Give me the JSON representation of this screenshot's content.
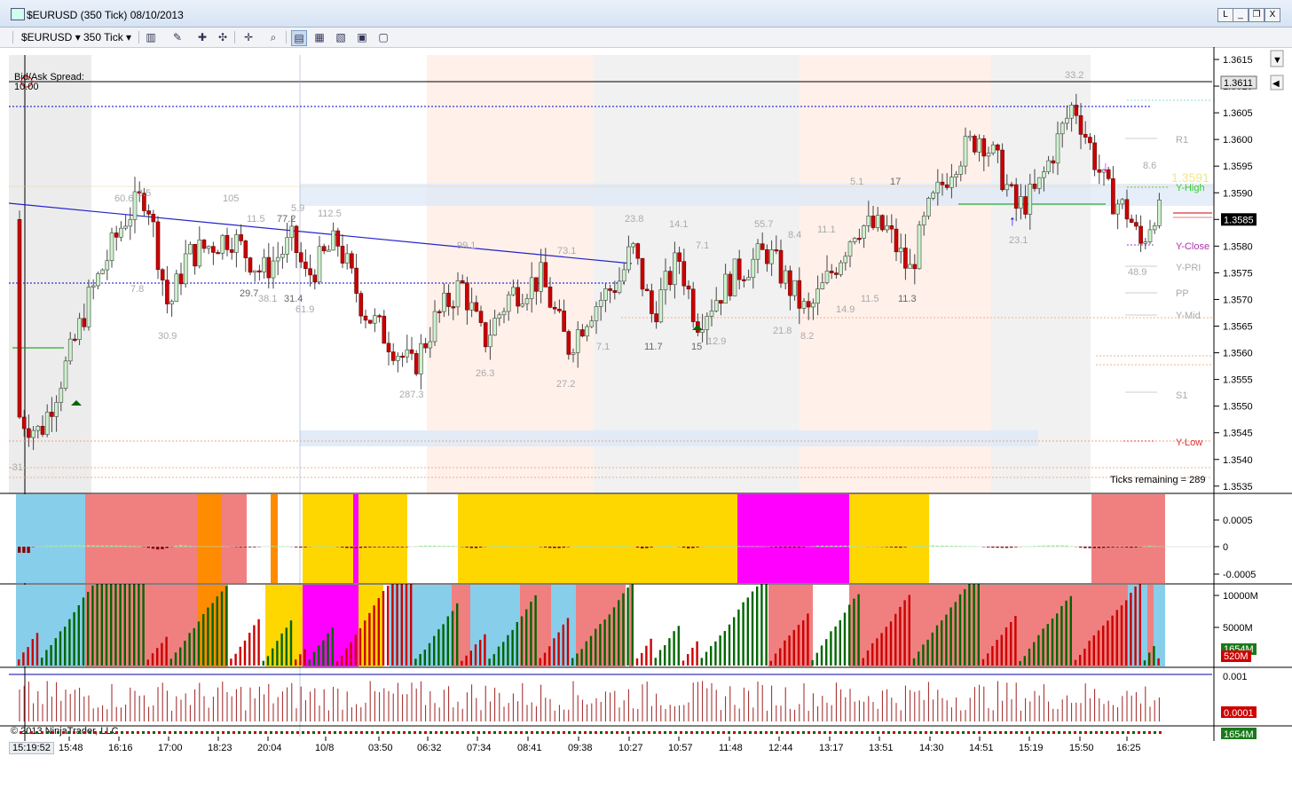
{
  "window": {
    "title": "$EURUSD (350 Tick)  08/10/2013",
    "btn_help": "L",
    "btn_min": "_",
    "btn_max": "❐",
    "btn_close": "X"
  },
  "toolbar": {
    "instrument": "$EURUSD",
    "interval": "350 Tick"
  },
  "chart": {
    "bid_ask_label": "Bid/Ask Spread:",
    "bid_ask_value": "10.00",
    "ticks_remaining": "Ticks remaining = 289",
    "copyright": "© 2013 NinjaTrader, LLC",
    "cursor_time": "15:19:52",
    "price_axis": [
      "1.3615",
      "1.3610",
      "1.3605",
      "1.3600",
      "1.3595",
      "1.3590",
      "1.3585",
      "1.3580",
      "1.3575",
      "1.3570",
      "1.3565",
      "1.3560",
      "1.3555",
      "1.3550",
      "1.3545",
      "1.3540",
      "1.3535"
    ],
    "last_price": "1.3585",
    "cursor_price": "1.3611",
    "time_axis": [
      "15:48",
      "16:16",
      "17:00",
      "18:23",
      "20:04",
      "10/8",
      "03:50",
      "06:32",
      "07:34",
      "08:41",
      "09:38",
      "10:27",
      "10:57",
      "11:48",
      "12:44",
      "13:17",
      "13:51",
      "14:30",
      "14:51",
      "15:19",
      "15:50",
      "16:25"
    ],
    "levels": {
      "r1": "R1",
      "y_high": "Y-High",
      "y_high_val": "1.3591",
      "y_close": "Y-Close",
      "y_pri": "Y-PRI",
      "pp": "PP",
      "y_mid": "Y-Mid",
      "s1": "S1",
      "y_low": "Y-Low"
    },
    "swing_labels": [
      "60.6",
      "3.5",
      "105",
      "11.5",
      "77.2",
      "5.9",
      "112.5",
      "7.8",
      "29.7",
      "38.1",
      "31.4",
      "61.9",
      "30.9",
      "287.3",
      "26.3",
      "23.8",
      "14.1",
      "7.1",
      "55.7",
      "8.4",
      "11.1",
      "5.1",
      "17",
      "33.2",
      "8.6",
      "23.1",
      "48.9",
      "27.2",
      "7.1",
      "11.7",
      "15",
      "12.9",
      "21.8",
      "8.2",
      "14.9",
      "11.5",
      "11.3",
      "-31",
      "73.1",
      "99.1"
    ]
  },
  "osc": {
    "axis": [
      "0.0005",
      "0",
      "-0.0005"
    ]
  },
  "vol": {
    "axis": [
      "10000M",
      "5000M"
    ],
    "tag_green": "1654M",
    "tag_red": "520M"
  },
  "pnl": {
    "axis": [
      "0.001"
    ],
    "tag": "0.0001",
    "tag_bottom": "1654M"
  },
  "colors": {
    "up": "#33cc33",
    "down": "#cc0000",
    "dark_green": "#006600",
    "light_green": "#99ee99",
    "dark_red": "#880000",
    "blue_bg": "#87ceeb",
    "red_bg": "#f08080",
    "gold_bg": "#ffd700",
    "magenta_bg": "#ff00ff",
    "orange_bg": "#ff8c00"
  }
}
